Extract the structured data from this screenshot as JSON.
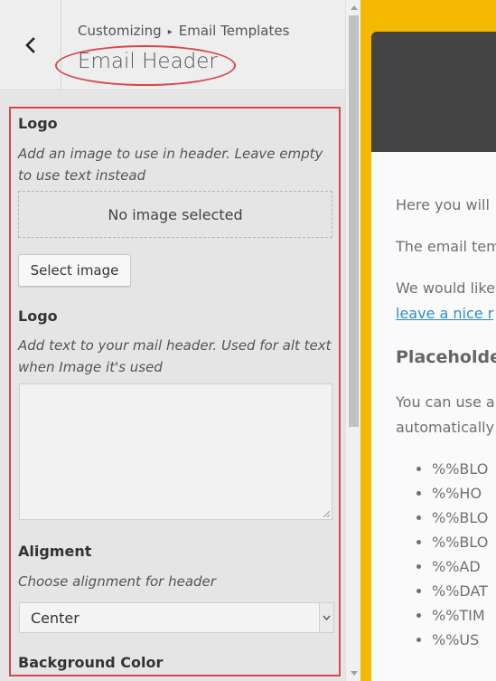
{
  "header": {
    "breadcrumb_root": "Customizing",
    "breadcrumb_parent": "Email Templates",
    "section_title": "Email Header"
  },
  "logo_image": {
    "title": "Logo",
    "description": "Add an image to use in header. Leave empty to use text instead",
    "placeholder": "No image selected",
    "button_label": "Select image"
  },
  "logo_text": {
    "title": "Logo",
    "description": "Add text to your mail header. Used for alt text when Image it's used",
    "value": ""
  },
  "alignment": {
    "title": "Aligment",
    "description": "Choose alignment for header",
    "selected": "Center"
  },
  "background": {
    "title": "Background Color"
  },
  "preview": {
    "line1": "Here you will",
    "line2": "The email tem",
    "line3": "We would like",
    "link": "leave a nice r",
    "heading": "Placeholde",
    "line4": "You can use a",
    "line5": "automatically",
    "placeholders": [
      "%%BLO",
      "%%HO",
      "%%BLO",
      "%%BLO",
      "%%AD",
      "%%DAT",
      "%%TIM",
      "%%US"
    ]
  },
  "colors": {
    "preview_background": "#f5b800",
    "preview_header": "#444444",
    "highlight": "#d9464b",
    "link": "#2a8fc8"
  }
}
